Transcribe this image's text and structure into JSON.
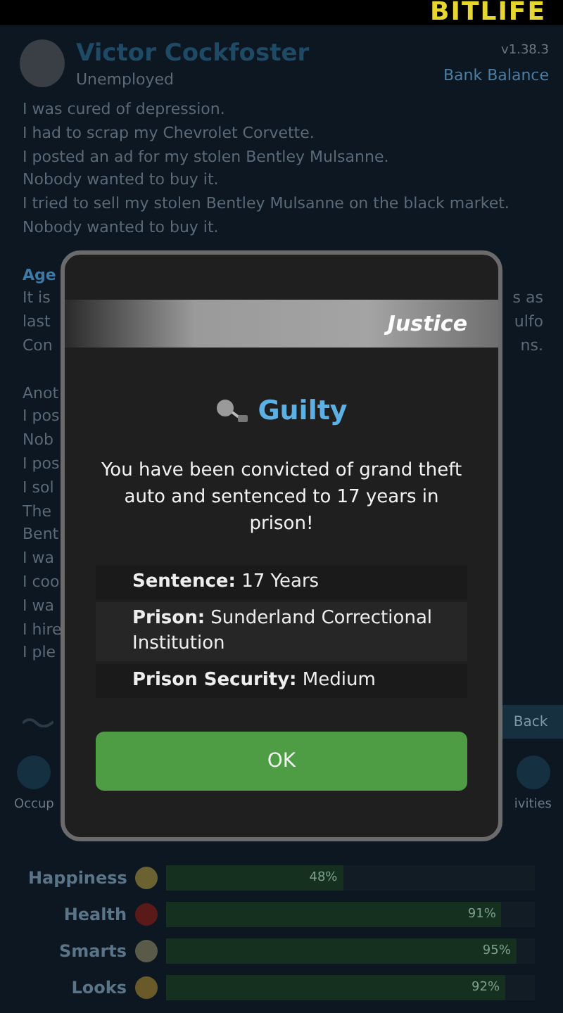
{
  "top_bar": {
    "logo": "BITLIFE"
  },
  "header": {
    "name": "Victor Cockfoster",
    "status": "Unemployed",
    "bank_label": "Bank Balance",
    "version": "v1.38.3"
  },
  "log": {
    "lines": [
      "I was cured of depression.",
      "I had to scrap my Chevrolet Corvette.",
      "I posted an ad for my stolen Bentley Mulsanne.",
      "Nobody wanted to buy it.",
      "I tried to sell my stolen Bentley Mulsanne on the black market.",
      "Nobody wanted to buy it."
    ],
    "fragments": [
      {
        "kind": "gap"
      },
      {
        "kind": "heading",
        "left": "Age"
      },
      {
        "kind": "line",
        "left": "It is",
        "right": "s as"
      },
      {
        "kind": "line",
        "left": "last",
        "right": "ulfo"
      },
      {
        "kind": "line",
        "left": "Con",
        "right": "ns."
      },
      {
        "kind": "gap"
      },
      {
        "kind": "line",
        "left": "Anot"
      },
      {
        "kind": "line",
        "left": "I pos"
      },
      {
        "kind": "line",
        "left": "Nob"
      },
      {
        "kind": "line",
        "left": "I pos"
      },
      {
        "kind": "line",
        "left": "I sol"
      },
      {
        "kind": "line",
        "left": "The"
      },
      {
        "kind": "line",
        "left": "Bent"
      },
      {
        "kind": "line",
        "left": "I wa"
      },
      {
        "kind": "line",
        "left": "I coo"
      },
      {
        "kind": "line",
        "left": "I wa"
      },
      {
        "kind": "line",
        "left": "I hire"
      },
      {
        "kind": "line",
        "left": "I ple"
      }
    ]
  },
  "nav": {
    "back": "Back"
  },
  "actions": [
    {
      "label": "Occup"
    },
    {
      "label": "ivities"
    }
  ],
  "stats": [
    {
      "label": "Happiness",
      "value": "48%",
      "level": 0.48
    },
    {
      "label": "Health",
      "value": "91%",
      "level": 0.91
    },
    {
      "label": "Smarts",
      "value": "95%",
      "level": 0.95
    },
    {
      "label": "Looks",
      "value": "92%",
      "level": 0.92
    }
  ],
  "dialog": {
    "banner": "Justice",
    "title": "Guilty",
    "message": "You have been convicted of grand theft auto and sentenced to 17 years in prison!",
    "details": [
      {
        "label": "Sentence:",
        "value": "17 Years"
      },
      {
        "label": "Prison:",
        "value": "Sunderland Correctional Institution"
      },
      {
        "label": "Prison Security:",
        "value": "Medium"
      }
    ],
    "button": "OK"
  }
}
